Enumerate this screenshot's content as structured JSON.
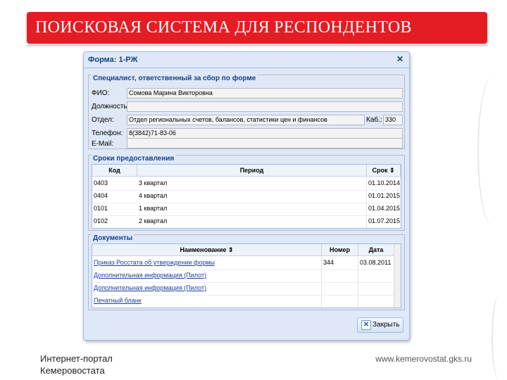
{
  "slide": {
    "title": "ПОИСКОВАЯ СИСТЕМА ДЛЯ РЕСПОНДЕНТОВ",
    "footer_left_line1": "Интернет-портал",
    "footer_left_line2": "Кемеровостата",
    "footer_right": "www.kemerovostat.gks.ru",
    "accent_color": "#e31d23"
  },
  "window": {
    "title": "Форма: 1-РЖ",
    "close_icon": "close-icon"
  },
  "specialist": {
    "legend": "Специалист, ответственный за сбор по форме",
    "fio_label": "ФИО:",
    "fio_value": "Сомова Марина Викторовна",
    "position_label": "Должность:",
    "position_value": "",
    "dept_label": "Отдел:",
    "dept_value": "Отдел региональных счетов, балансов, статистики цен и финансов",
    "room_label": "Каб.:",
    "room_value": "330",
    "phone_label": "Телефон:",
    "phone_value": "8(3842)71-83-06",
    "email_label": "E-Mail:",
    "email_value": ""
  },
  "deadlines": {
    "legend": "Сроки предоставления",
    "columns": [
      "Код",
      "Период",
      "Срок"
    ],
    "rows": [
      {
        "code": "0403",
        "period": "3 квартал",
        "date": "01.10.2014"
      },
      {
        "code": "0404",
        "period": "4 квартал",
        "date": "01.01.2015"
      },
      {
        "code": "0101",
        "period": "1 квартал",
        "date": "01.04.2015"
      },
      {
        "code": "0102",
        "period": "2 квартал",
        "date": "01.07.2015"
      }
    ]
  },
  "documents": {
    "legend": "Документы",
    "columns": [
      "Наименование",
      "Номер",
      "Дата"
    ],
    "rows": [
      {
        "name": "Приказ Росстата об утверждении формы",
        "number": "344",
        "date": "03.08.2011"
      },
      {
        "name": "Дополнительная информация (Пилот)",
        "number": "",
        "date": ""
      },
      {
        "name": "Дополнительная информация (Пилот)",
        "number": "",
        "date": ""
      },
      {
        "name": "Печатный бланк",
        "number": "",
        "date": ""
      }
    ]
  },
  "close_button": {
    "label": "Закрыть"
  }
}
